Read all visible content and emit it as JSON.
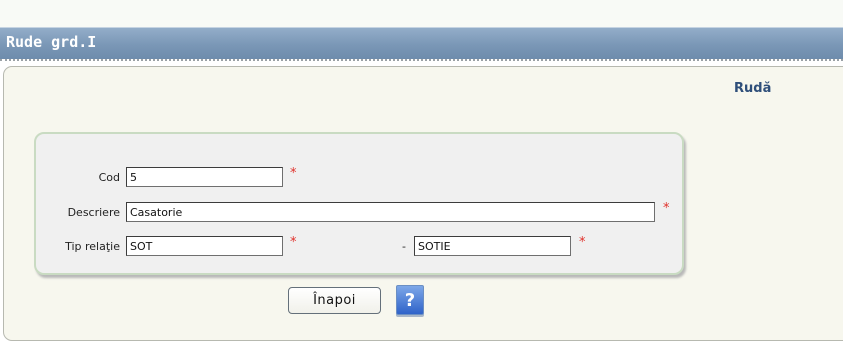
{
  "window": {
    "title": "Rude grd.I"
  },
  "panel": {
    "heading": "Rudă"
  },
  "form": {
    "cod": {
      "label": "Cod",
      "value": "5",
      "required_mark": "*"
    },
    "descriere": {
      "label": "Descriere",
      "value": "Casatorie",
      "required_mark": "*"
    },
    "tip_relatie": {
      "label": "Tip relaţie",
      "value": "SOT",
      "required_mark": "*",
      "separator": "-",
      "pair_value": "SOTIE",
      "pair_required_mark": "*"
    }
  },
  "buttons": {
    "back_label": "Înapoi",
    "help_label": "?"
  },
  "colors": {
    "titlebar": "#7a97b6",
    "panel_bg": "#f7f7ee",
    "form_bg": "#f0f0f0",
    "required": "#e0302a",
    "heading": "#2f4f7a"
  },
  "icons": {
    "help": "help-icon"
  }
}
